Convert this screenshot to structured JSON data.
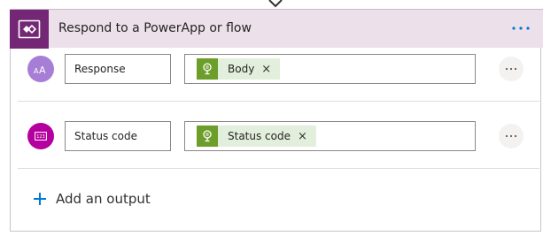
{
  "header": {
    "title": "Respond to a PowerApp or flow",
    "icon": "powerapps-icon",
    "more_icon": "ellipsis-icon",
    "color": "#742774"
  },
  "outputs": [
    {
      "type_icon": "text-type-icon",
      "type_color": "#a77ed6",
      "name": "Response",
      "token_label": "Body",
      "token_icon": "dynamic-content-icon",
      "remove_glyph": "×"
    },
    {
      "type_icon": "number-type-icon",
      "type_color": "#b4009e",
      "name": "Status code",
      "token_label": "Status code",
      "token_icon": "dynamic-content-icon",
      "remove_glyph": "×"
    }
  ],
  "add_output": {
    "label": "Add an output",
    "icon": "plus-icon",
    "accent": "#0078d4"
  }
}
